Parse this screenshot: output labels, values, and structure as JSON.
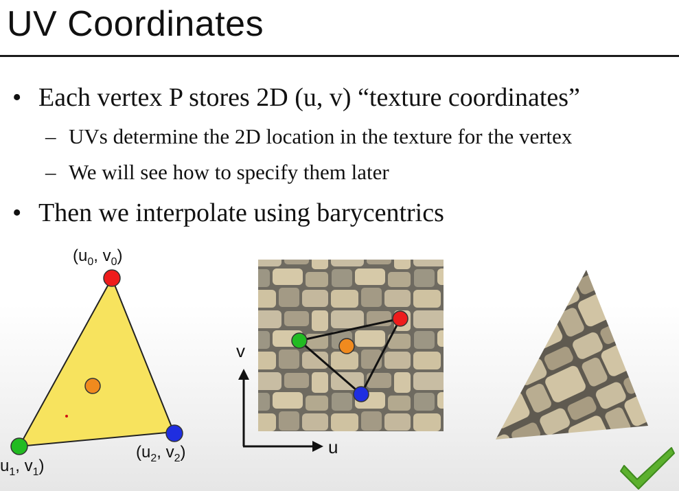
{
  "slide": {
    "title": "UV Coordinates",
    "bullets": [
      {
        "text": "Each vertex P stores 2D (u, v) “texture coordinates”",
        "sub": [
          "UVs determine the 2D location in the texture for the vertex",
          "We will see how to specify them later"
        ]
      },
      {
        "text": "Then we interpolate using barycentrics"
      }
    ],
    "bullet_glyph": "•",
    "dash_glyph": "–"
  },
  "diagram": {
    "vertex_labels": {
      "v0": {
        "prefix": "(u",
        "sub1": "0",
        "mid": ", v",
        "sub2": "0",
        "suffix": ")"
      },
      "v1": {
        "prefix": "u",
        "sub1": "1",
        "mid": ", v",
        "sub2": "1",
        "suffix": ")"
      },
      "v2": {
        "prefix": "(u",
        "sub1": "2",
        "mid": ", v",
        "sub2": "2",
        "suffix": ")"
      }
    },
    "axis_labels": {
      "v": "v",
      "u": "u"
    },
    "colors": {
      "triangle_fill": "#f7e35e",
      "v0": "#ee1c1c",
      "v1": "#22bb22",
      "v2": "#1f2ee0",
      "interior_point": "#f08a1e",
      "checkmark": "#5cb02e"
    },
    "icons": [
      "checkmark-icon"
    ]
  }
}
